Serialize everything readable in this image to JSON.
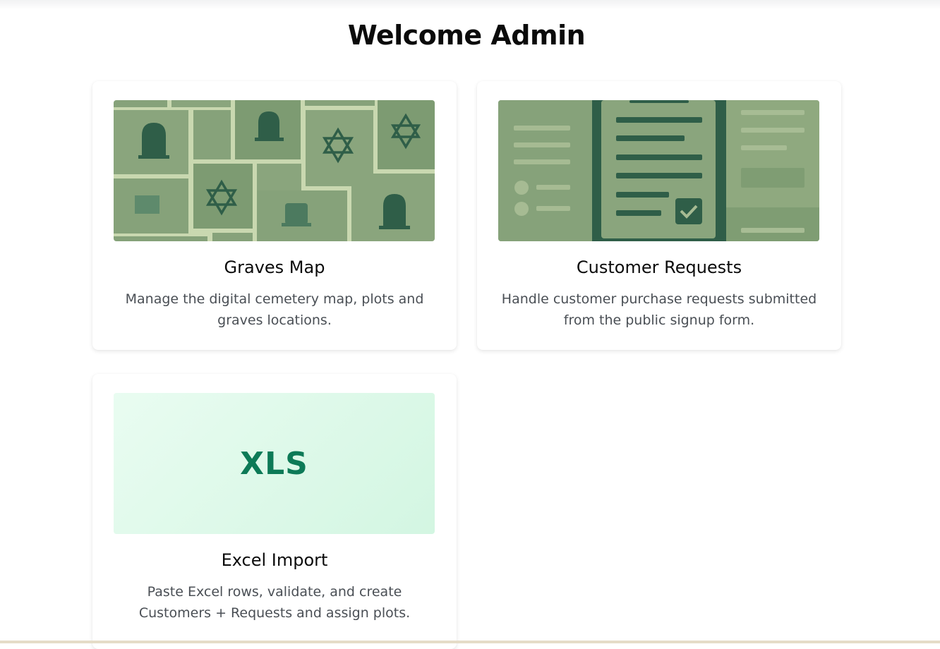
{
  "header": {
    "title": "Welcome Admin"
  },
  "cards": [
    {
      "title": "Graves Map",
      "description": "Manage the digital cemetery map, plots and graves locations.",
      "icon": "cemetery-map-illustration"
    },
    {
      "title": "Customer Requests",
      "description": "Handle customer purchase requests submitted from the public signup form.",
      "icon": "request-form-illustration"
    },
    {
      "title": "Excel Import",
      "description": "Paste Excel rows, validate, and create Customers + Requests and assign plots.",
      "image_text": "XLS",
      "icon": "xls-badge"
    }
  ],
  "colors": {
    "map_bg": "#8aa57d",
    "map_dark": "#2f5e48",
    "map_line": "#c9d8b0",
    "xls_text": "#0d7a57",
    "xls_bg": "#dff8ea",
    "desc_text": "#4a4f55"
  }
}
